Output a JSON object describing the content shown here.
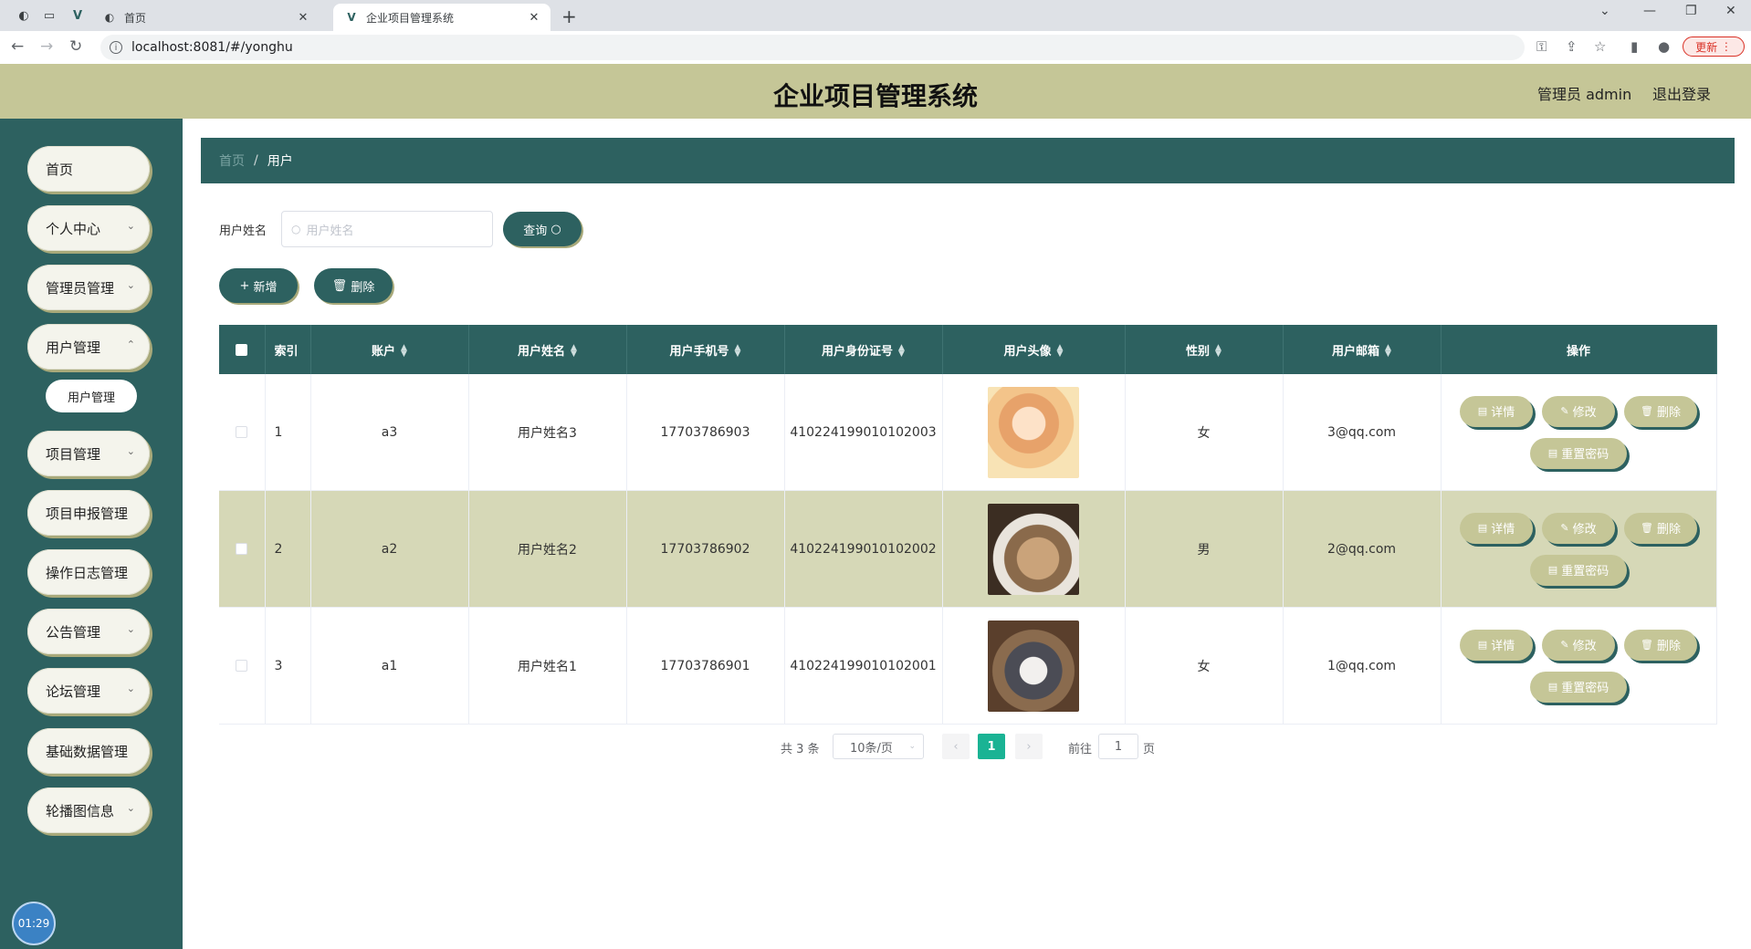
{
  "browser": {
    "tabs": [
      {
        "title": "首页",
        "active": false
      },
      {
        "title": "企业项目管理系统",
        "active": true
      }
    ],
    "url": "localhost:8081/#/yonghu",
    "update_label": "更新"
  },
  "header": {
    "title": "企业项目管理系统",
    "user": "管理员 admin",
    "logout": "退出登录"
  },
  "sidebar": {
    "items": [
      {
        "label": "首页",
        "chevron": false
      },
      {
        "label": "个人中心",
        "chevron": true
      },
      {
        "label": "管理员管理",
        "chevron": true
      },
      {
        "label": "用户管理",
        "chevron": true
      },
      {
        "label": "项目管理",
        "chevron": true
      },
      {
        "label": "项目申报管理",
        "chevron": false
      },
      {
        "label": "操作日志管理",
        "chevron": false
      },
      {
        "label": "公告管理",
        "chevron": true
      },
      {
        "label": "论坛管理",
        "chevron": true
      },
      {
        "label": "基础数据管理",
        "chevron": false
      },
      {
        "label": "轮播图信息",
        "chevron": true
      }
    ],
    "submenu_label": "用户管理",
    "clock": "01:29"
  },
  "breadcrumb": {
    "home": "首页",
    "separator": "/",
    "current": "用户"
  },
  "search": {
    "label": "用户姓名",
    "placeholder": "用户姓名",
    "query_button": "查询"
  },
  "actions": {
    "add": "新增",
    "delete": "删除"
  },
  "table": {
    "headers": {
      "index": "索引",
      "account": "账户",
      "name": "用户姓名",
      "phone": "用户手机号",
      "idcard": "用户身份证号",
      "avatar": "用户头像",
      "gender": "性别",
      "email": "用户邮箱",
      "ops": "操作"
    },
    "rows": [
      {
        "index": "1",
        "account": "a3",
        "name": "用户姓名3",
        "phone": "17703786903",
        "idcard": "410224199010102003",
        "gender": "女",
        "email": "3@qq.com"
      },
      {
        "index": "2",
        "account": "a2",
        "name": "用户姓名2",
        "phone": "17703786902",
        "idcard": "410224199010102002",
        "gender": "男",
        "email": "2@qq.com"
      },
      {
        "index": "3",
        "account": "a1",
        "name": "用户姓名1",
        "phone": "17703786901",
        "idcard": "410224199010102001",
        "gender": "女",
        "email": "1@qq.com"
      }
    ],
    "op_labels": {
      "detail": "详情",
      "edit": "修改",
      "delete": "删除",
      "reset": "重置密码"
    }
  },
  "pagination": {
    "total": "共 3 条",
    "page_size": "10条/页",
    "current_page": "1",
    "goto_label": "前往",
    "goto_value": "1",
    "page_suffix": "页"
  },
  "colors": {
    "primary": "#2d6160",
    "accent": "#c5c697",
    "row_highlight": "#d6d8b7",
    "pager_active": "#1ab394"
  }
}
